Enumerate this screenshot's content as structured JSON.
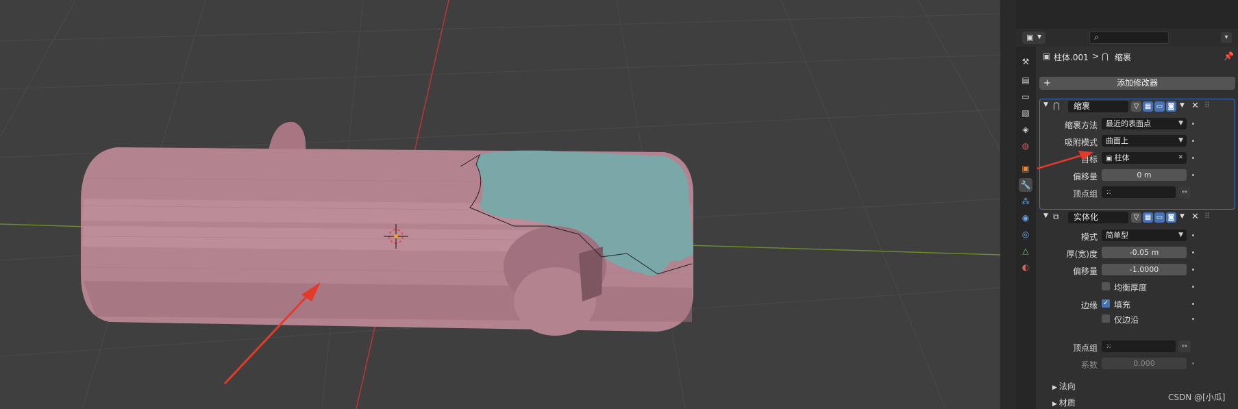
{
  "viewport": {
    "description_colors": {
      "background": "#3f3f3f",
      "mesh": "#b3838f",
      "shrinkwrap_surface": "#7aa8a8",
      "x_axis": "#b83636",
      "y_axis": "#6a8c2a",
      "annotation_arrow": "#e23b2b"
    }
  },
  "header": {
    "editor_icon": "properties-editor-icon",
    "search_icon": "search-icon",
    "options_icon": "options-icon"
  },
  "tabs": [
    "tool-icon",
    "render-icon",
    "output-icon",
    "view-layer-icon",
    "scene-icon",
    "world-icon",
    "object-icon",
    "modifier-icon",
    "particles-icon",
    "physics-icon",
    "constraints-icon",
    "data-icon",
    "material-icon"
  ],
  "breadcrumb": {
    "object": "柱体.001",
    "separator": ">",
    "modifier": "缩裹"
  },
  "add_modifier": {
    "plus": "+",
    "label": "添加修改器"
  },
  "modifiers": [
    {
      "name": "缩裹",
      "props": [
        {
          "label": "缩裹方法",
          "value": "最近的表面点"
        },
        {
          "label": "吸附模式",
          "value": "曲面上"
        },
        {
          "label": "目标",
          "value": "柱体"
        },
        {
          "label": "偏移量",
          "value": "0 m"
        },
        {
          "label": "顶点组",
          "value": ""
        }
      ]
    },
    {
      "name": "实体化",
      "props": [
        {
          "label": "模式",
          "value": "简单型"
        },
        {
          "label": "厚(宽)度",
          "value": "-0.05 m"
        },
        {
          "label": "偏移量",
          "value": "-1.0000"
        },
        {
          "label": "",
          "checkbox": "均衡厚度",
          "checked": false
        },
        {
          "label": "边缘",
          "checkbox": "填充",
          "checked": true
        },
        {
          "label": "",
          "checkbox": "仅边沿",
          "checked": false
        },
        {
          "label": "顶点组",
          "value": ""
        },
        {
          "label": "系数",
          "value": "0.000"
        }
      ],
      "subpanels": [
        "法向",
        "材质"
      ]
    }
  ],
  "watermark": "CSDN @[小瓜]"
}
